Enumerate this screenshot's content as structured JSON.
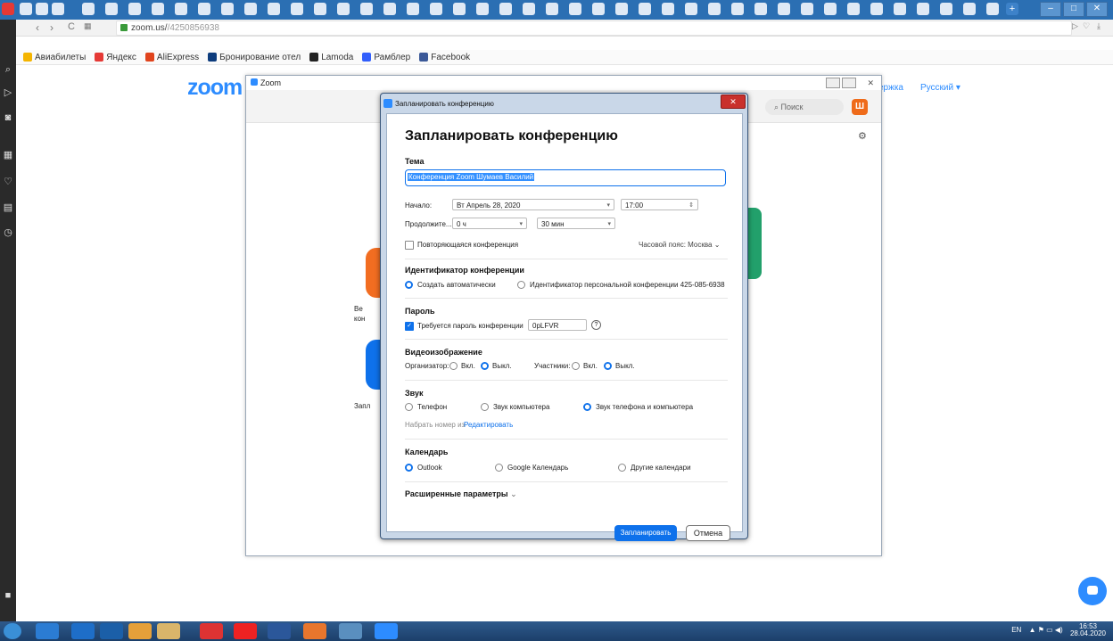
{
  "browser": {
    "url": "zoom.us/",
    "url_path": "/4250856938",
    "bookmarks": [
      "Авиабилеты",
      "Яндекс",
      "AliExpress",
      "Бронирование отел",
      "Lamoda",
      "Рамблер",
      "Facebook"
    ]
  },
  "page": {
    "logo": "zoom",
    "support": "ержка",
    "language": "Русский ▾"
  },
  "zoom_window": {
    "title": "Zoom",
    "search_placeholder": "Поиск",
    "avatar_letter": "Ш",
    "tile_labels": [
      "Ве",
      "кон",
      "Запл"
    ]
  },
  "dialog": {
    "window_title": "Запланировать конференцию",
    "heading": "Запланировать конференцию",
    "topic_label": "Тема",
    "topic_value": "Конференция Zoom Шумаев Василий",
    "start_label": "Начало:",
    "start_date": "Вт Апрель 28, 2020",
    "start_time": "17:00",
    "duration_label": "Продолжите...",
    "duration_hours": "0 ч",
    "duration_minutes": "30 мин",
    "recurring_label": "Повторяющаяся конференция",
    "timezone": "Часовой пояс: Москва",
    "meeting_id_title": "Идентификатор конференции",
    "meeting_id_auto": "Создать автоматически",
    "meeting_id_personal": "Идентификатор персональной конференции 425-085-6938",
    "password_title": "Пароль",
    "password_required": "Требуется пароль конференции",
    "password_value": "0pLFVR",
    "video_title": "Видеоизображение",
    "video_host": "Организатор:",
    "video_on": "Вкл.",
    "video_off": "Выкл.",
    "video_participants": "Участники:",
    "audio_title": "Звук",
    "audio_phone": "Телефон",
    "audio_computer": "Звук компьютера",
    "audio_both": "Звук телефона и компьютера",
    "dial_from": "Набрать номер из",
    "edit_link": "Редактировать",
    "calendar_title": "Календарь",
    "cal_outlook": "Outlook",
    "cal_google": "Google Календарь",
    "cal_other": "Другие календари",
    "advanced": "Расширенные параметры",
    "schedule_button": "Запланировать",
    "cancel_button": "Отмена"
  },
  "tray": {
    "lang": "EN",
    "time": "16:53",
    "date": "28.04.2020"
  }
}
